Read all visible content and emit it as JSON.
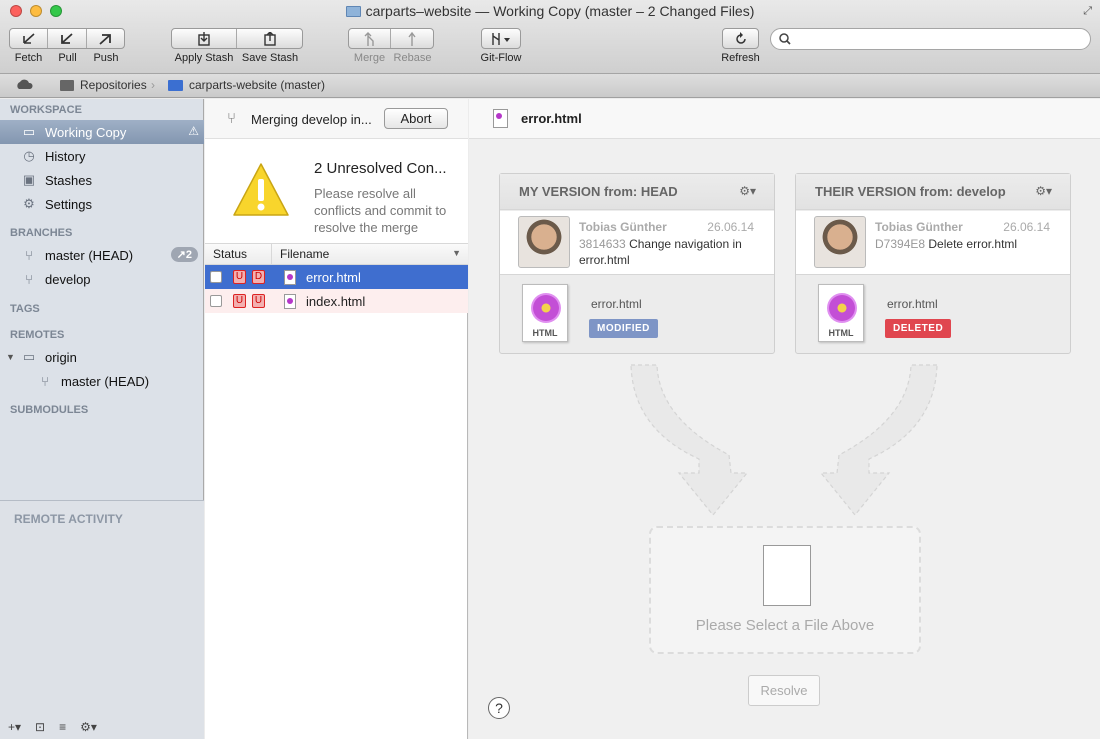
{
  "window": {
    "title": "carparts–website — Working Copy (master – 2 Changed Files)"
  },
  "toolbar": {
    "fetch": "Fetch",
    "pull": "Pull",
    "push": "Push",
    "apply_stash": "Apply Stash",
    "save_stash": "Save Stash",
    "merge": "Merge",
    "rebase": "Rebase",
    "gitflow": "Git-Flow",
    "refresh": "Refresh",
    "search_placeholder": ""
  },
  "pathbar": {
    "repositories": "Repositories",
    "current": "carparts-website (master)"
  },
  "sidebar": {
    "workspace_header": "WORKSPACE",
    "workspace_items": [
      {
        "label": "Working Copy",
        "icon": "folder-icon",
        "selected": true
      },
      {
        "label": "History",
        "icon": "clock-icon"
      },
      {
        "label": "Stashes",
        "icon": "stash-icon"
      },
      {
        "label": "Settings",
        "icon": "gear-icon"
      }
    ],
    "branches_header": "BRANCHES",
    "branches": [
      {
        "label": "master (HEAD)",
        "badge": "↗2"
      },
      {
        "label": "develop"
      }
    ],
    "tags_header": "TAGS",
    "remotes_header": "REMOTES",
    "remotes": [
      {
        "label": "origin"
      },
      {
        "label": "master (HEAD)"
      }
    ],
    "submodules_header": "SUBMODULES",
    "remote_activity_header": "REMOTE ACTIVITY"
  },
  "merge": {
    "status": "Merging develop in...",
    "abort": "Abort",
    "conflicts_title": "2 Unresolved Con...",
    "conflicts_desc": "Please resolve all conflicts and commit to resolve the merge"
  },
  "files": {
    "col_status": "Status",
    "col_filename": "Filename",
    "rows": [
      {
        "name": "error.html",
        "status1": "U",
        "status2": "D"
      },
      {
        "name": "index.html",
        "status1": "U",
        "status2": "U"
      }
    ]
  },
  "detail": {
    "filename": "error.html",
    "mine": {
      "header": "MY VERSION from: HEAD",
      "author": "Tobias Günther",
      "date": "26.06.14",
      "hash": "3814633",
      "message": "Change navigation in error.html",
      "file": "error.html",
      "file_type": "HTML",
      "tag": "MODIFIED",
      "tag_color": "#7e95c6"
    },
    "theirs": {
      "header": "THEIR VERSION from: develop",
      "author": "Tobias Günther",
      "date": "26.06.14",
      "hash": "D7394E8",
      "message": "Delete error.html",
      "file": "error.html",
      "file_type": "HTML",
      "tag": "DELETED",
      "tag_color": "#e0464f"
    },
    "drop_text": "Please Select a File Above",
    "resolve": "Resolve",
    "help": "?"
  }
}
